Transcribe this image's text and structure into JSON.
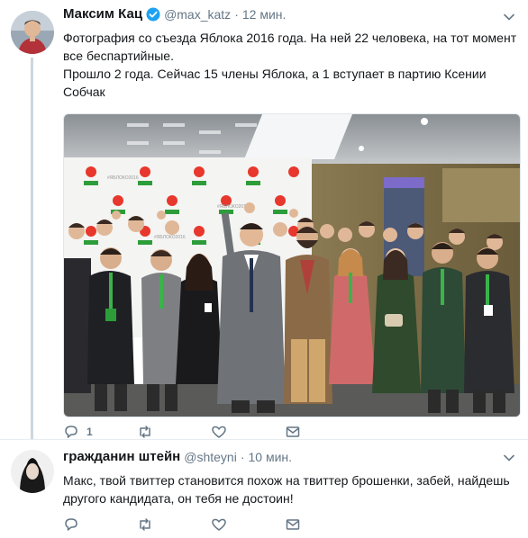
{
  "tweet1": {
    "name": "Максим Кац",
    "handle": "@max_katz",
    "time": "12 мин.",
    "text_lines": [
      "Фотография со съезда Яблока 2016 года. На ней 22 человека, на тот момент все беспартийные.",
      "Прошло 2 года. Сейчас 15 члены Яблока, а 1 вступает в партию Ксении Собчак"
    ],
    "reply_count": "1",
    "photo_wall_text": "#ЯБЛОКО2016"
  },
  "tweet2": {
    "name": "гражданин штейн",
    "handle": "@shteyni",
    "time": "10 мин.",
    "text": "Макс, твой твиттер становится похож на твиттер брошенки, забей, найдешь другого кандидата, он тебя не достоин!"
  },
  "icons": {
    "reply": "reply-icon",
    "retweet": "retweet-icon",
    "like": "heart-icon",
    "dm": "envelope-icon",
    "verified": "verified-badge-icon",
    "more": "chevron-down-icon"
  },
  "colors": {
    "text": "#14171a",
    "secondary": "#657786",
    "verified": "#1da1f2",
    "yabloko_green": "#2d9d3a",
    "yabloko_red": "#e8372c"
  }
}
